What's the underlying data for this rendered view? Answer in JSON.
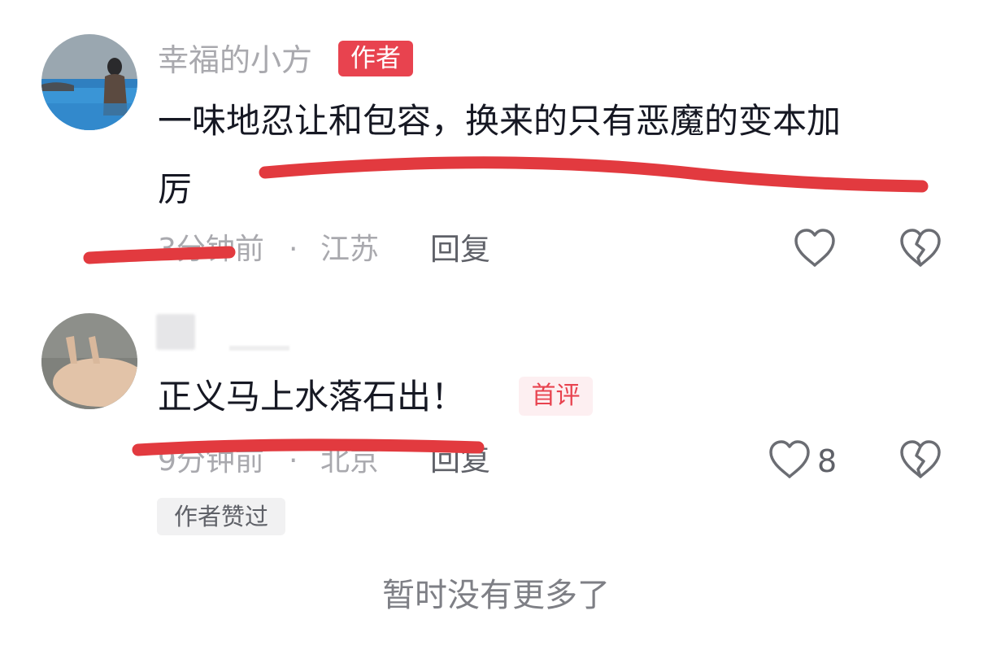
{
  "comments": [
    {
      "username": "幸福的小方",
      "author_badge": "作者",
      "text_line1": "一味地忍让和包容，换来的只有恶魔的变本加",
      "text_line2": "厉",
      "time": "3分钟前",
      "location_sep": "·",
      "location": "江苏",
      "reply_label": "回复",
      "like_count": ""
    },
    {
      "username": "",
      "text": "正义马上水落石出！",
      "first_badge": "首评",
      "time": "9分钟前",
      "location_sep": "·",
      "location": "北京",
      "reply_label": "回复",
      "like_count": "8",
      "author_liked": "作者赞过"
    }
  ],
  "footer_text": "暂时没有更多了",
  "colors": {
    "accent_red": "#e8434f",
    "markup_red": "#e23a3f",
    "muted_text": "#a9a9ae"
  },
  "icons": [
    "heart-outline-icon",
    "broken-heart-icon"
  ]
}
